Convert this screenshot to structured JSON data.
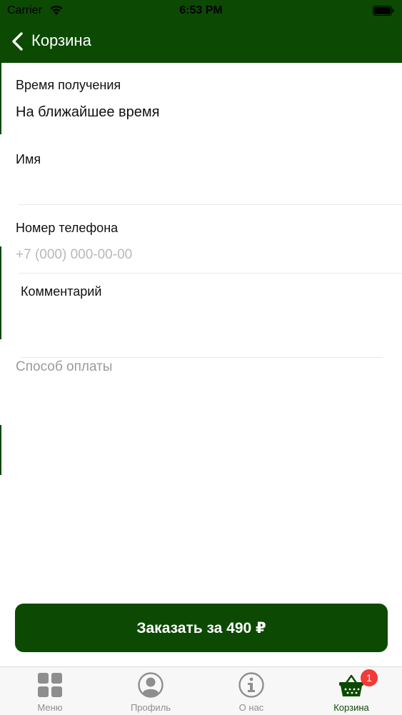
{
  "status_bar": {
    "carrier": "Carrier",
    "time": "6:53 PM"
  },
  "header": {
    "back_icon": "chevron-left-icon",
    "title": "Корзина"
  },
  "form": {
    "pickup_time": {
      "label": "Время получения",
      "value": "На ближайшее время"
    },
    "name": {
      "label": "Имя",
      "value": "",
      "placeholder": ""
    },
    "phone": {
      "label": "Номер телефона",
      "value": "",
      "placeholder": "+7 (000) 000-00-00"
    },
    "comment": {
      "label": "Комментарий",
      "value": ""
    },
    "payment": {
      "placeholder": "Способ оплаты"
    }
  },
  "order_button": {
    "label": "Заказать за 490 ₽"
  },
  "tab_bar": {
    "items": [
      {
        "label": "Меню",
        "icon": "grid-icon",
        "active": false
      },
      {
        "label": "Профиль",
        "icon": "user-icon",
        "active": false
      },
      {
        "label": "О нас",
        "icon": "info-icon",
        "active": false
      },
      {
        "label": "Корзина",
        "icon": "basket-icon",
        "active": true,
        "badge": "1"
      }
    ]
  },
  "colors": {
    "brand": "#0c4a04",
    "badge": "#f23a36",
    "inactive_tab": "#8e8e8e"
  }
}
